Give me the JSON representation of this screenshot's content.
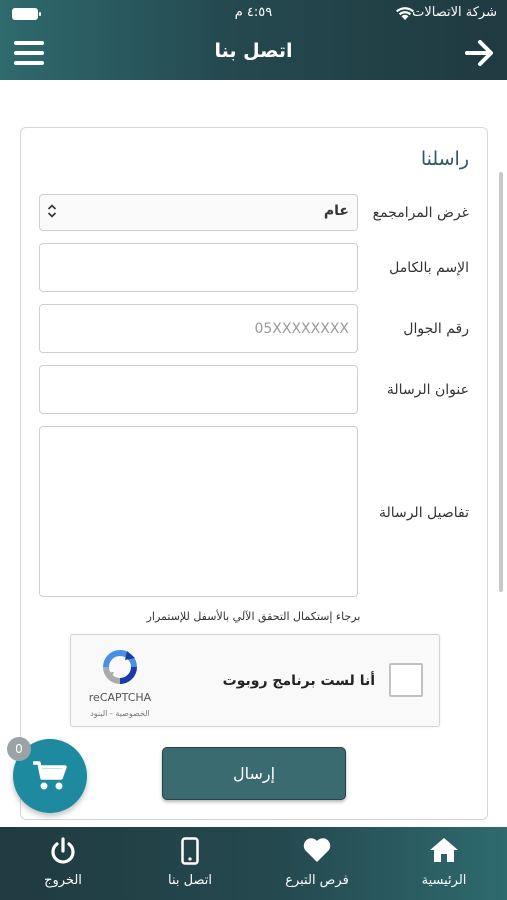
{
  "status_bar": {
    "carrier": "شركة الاتصالات",
    "time": "٤:٥٩ م"
  },
  "header": {
    "title": "اتصل بنا"
  },
  "form": {
    "section_title": "راسلنا",
    "purpose": {
      "label": "غرض المرامجمع",
      "value": "عام"
    },
    "full_name": {
      "label": "الإسم بالكامل",
      "value": ""
    },
    "mobile": {
      "label": "رقم الجوال",
      "placeholder": "05XXXXXXXX"
    },
    "subject": {
      "label": "عنوان الرسالة",
      "value": ""
    },
    "details": {
      "label": "تفاصيل الرسالة",
      "value": ""
    },
    "verify_note": "برجاء إستكمال التحقق الآلي بالأسفل للإستمرار",
    "captcha": {
      "label": "أنا لست برنامج روبوت",
      "brand": "reCAPTCHA",
      "terms": "الخصوصية - البنود"
    },
    "submit_label": "إرسال"
  },
  "cart": {
    "count": "0"
  },
  "tabs": [
    {
      "label": "الرئيسية",
      "icon": "home-icon"
    },
    {
      "label": "فرص التبرع",
      "icon": "heart-icon"
    },
    {
      "label": "اتصل بنا",
      "icon": "phone-icon"
    },
    {
      "label": "الخروج",
      "icon": "power-icon"
    }
  ],
  "colors": {
    "header": "#24494f",
    "accent": "#2b5c60",
    "button": "#3a6b70",
    "cart": "#1e8aa0"
  }
}
